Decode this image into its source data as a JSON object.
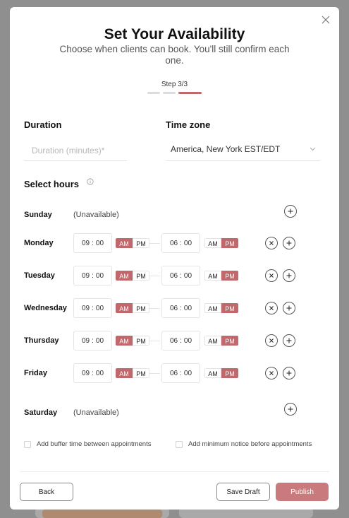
{
  "modal": {
    "title": "Set Your Availability",
    "subtitle": "Choose when clients can book. You'll still confirm each one.",
    "step_label": "Step 3/3",
    "steps": [
      false,
      false,
      true
    ]
  },
  "duration": {
    "label": "Duration",
    "placeholder": "Duration (minutes)*",
    "value": ""
  },
  "timezone": {
    "label": "Time zone",
    "value": "America, New York EST/EDT"
  },
  "hours": {
    "label": "Select hours",
    "days": [
      {
        "name": "Sunday",
        "available": false,
        "unavailable_text": "(Unavailable)"
      },
      {
        "name": "Monday",
        "available": true,
        "start": {
          "h": "09",
          "m": "00",
          "period": "AM"
        },
        "end": {
          "h": "06",
          "m": "00",
          "period": "PM"
        }
      },
      {
        "name": "Tuesday",
        "available": true,
        "start": {
          "h": "09",
          "m": "00",
          "period": "AM"
        },
        "end": {
          "h": "06",
          "m": "00",
          "period": "PM"
        }
      },
      {
        "name": "Wednesday",
        "available": true,
        "start": {
          "h": "09",
          "m": "00",
          "period": "AM"
        },
        "end": {
          "h": "06",
          "m": "00",
          "period": "PM"
        }
      },
      {
        "name": "Thursday",
        "available": true,
        "start": {
          "h": "09",
          "m": "00",
          "period": "AM"
        },
        "end": {
          "h": "06",
          "m": "00",
          "period": "PM"
        }
      },
      {
        "name": "Friday",
        "available": true,
        "start": {
          "h": "09",
          "m": "00",
          "period": "AM"
        },
        "end": {
          "h": "06",
          "m": "00",
          "period": "PM"
        }
      },
      {
        "name": "Saturday",
        "available": false,
        "unavailable_text": "(Unavailable)"
      }
    ],
    "am_label": "AM",
    "pm_label": "PM",
    "time_separator": ":"
  },
  "options": {
    "buffer_label": "Add buffer time between appointments",
    "notice_label": "Add minimum notice before appointments"
  },
  "footer": {
    "back_label": "Back",
    "draft_label": "Save Draft",
    "publish_label": "Publish"
  },
  "colors": {
    "accent": "#c0686b",
    "publish": "#c97a7d",
    "overlay": "#8f8f8f"
  },
  "icons": {
    "close": "close-icon",
    "chevron": "chevron-down-icon",
    "info": "info-icon",
    "add": "plus-icon",
    "remove": "x-icon"
  }
}
